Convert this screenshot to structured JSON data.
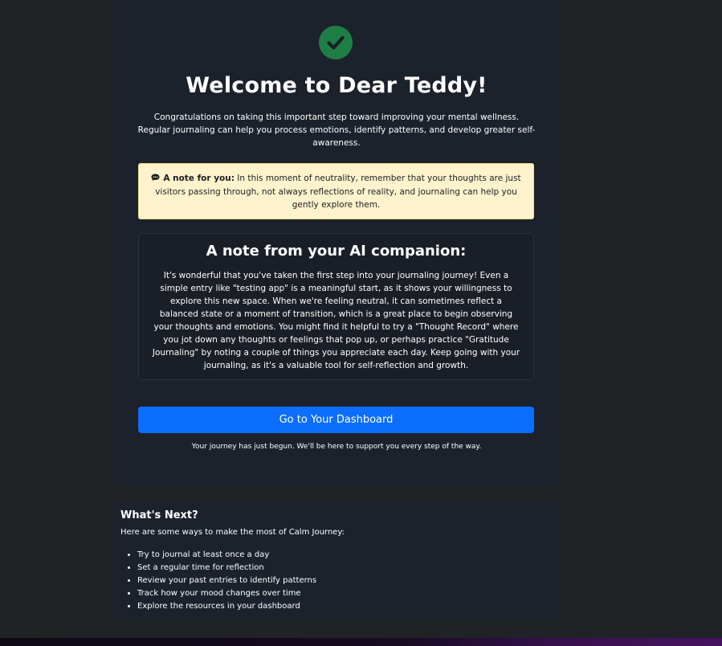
{
  "welcome": {
    "title": "Welcome to Dear Teddy!",
    "intro": "Congratulations on taking this important step toward improving your mental wellness. Regular journaling can help you process emotions, identify patterns, and develop greater self-awareness.",
    "check_icon": "check-circle-icon",
    "success_color": "#1f7e46"
  },
  "note": {
    "icon": "speech-bubble-icon",
    "label": "A note for you:",
    "text": " In this moment of neutrality, remember that your thoughts are just visitors passing through, not always reflections of reality, and journaling can help you gently explore them.",
    "background_color": "#fef3cd"
  },
  "ai_companion": {
    "title": "A note from your AI companion:",
    "body": "It's wonderful that you've taken the first step into your journaling journey! Even a simple entry like \"testing app\" is a meaningful start, as it shows your willingness to explore this new space. When we're feeling neutral, it can sometimes reflect a balanced state or a moment of transition, which is a great place to begin observing your thoughts and emotions. You might find it helpful to try a \"Thought Record\" where you jot down any thoughts or feelings that pop up, or perhaps practice \"Gratitude Journaling\" by noting a couple of things you appreciate each day. Keep going with your journaling, as it's a valuable tool for self-reflection and growth."
  },
  "actions": {
    "dashboard_label": "Go to Your Dashboard",
    "button_color": "#0b6efd"
  },
  "footnote": "Your journey has just begun. We'll be here to support you every step of the way.",
  "whats_next": {
    "title": "What's Next?",
    "subtitle": "Here are some ways to make the most of Calm Journey:",
    "items": [
      "Try to journal at least once a day",
      "Set a regular time for reflection",
      "Review your past entries to identify patterns",
      "Track how your mood changes over time",
      "Explore the resources in your dashboard"
    ]
  }
}
